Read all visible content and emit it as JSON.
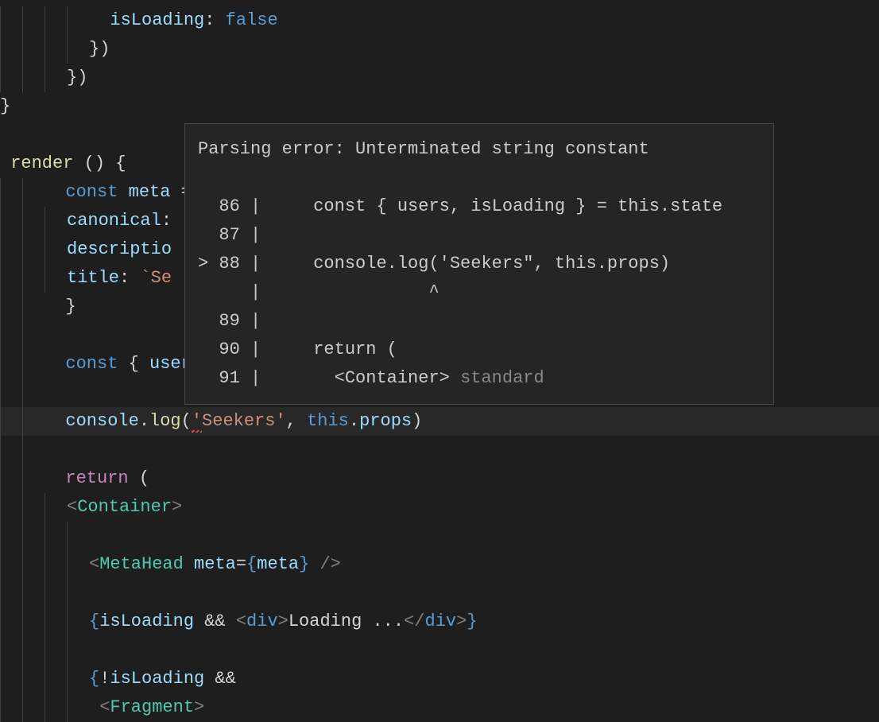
{
  "code": {
    "l1_prop": "isLoading",
    "l1_punc": ": ",
    "l1_val": "false",
    "l2": "})",
    "l3": "})",
    "l4": "}",
    "l6_func": "render",
    "l6_rest": " () {",
    "l7_const": "const",
    "l7_var": " meta",
    "l7_rest": " = ",
    "l8_prop": "canonical",
    "l8_punc": ":",
    "l9_prop": "descriptio",
    "l10_prop": "title",
    "l10_punc": ": ",
    "l10_tpl": "`Se",
    "l11": "}",
    "l13_const": "const",
    "l13_rest": " { ",
    "l13_var": "user",
    "l15_obj": "console",
    "l15_dot": ".",
    "l15_fn": "log",
    "l15_open": "(",
    "l15_quote": "'",
    "l15_str": "Seekers'",
    "l15_comma": ", ",
    "l15_this": "this",
    "l15_dot2": ".",
    "l15_props": "props",
    "l15_close": ")",
    "l17_return": "return",
    "l17_paren": " (",
    "l18_open": "<",
    "l18_tag": "Container",
    "l18_close": ">",
    "l20_open": "<",
    "l20_tag": "MetaHead",
    "l20_sp": " ",
    "l20_attr": "meta",
    "l20_eq": "=",
    "l20_bopen": "{",
    "l20_var": "meta",
    "l20_bclose": "}",
    "l20_end": " />",
    "l22_bopen": "{",
    "l22_var": "isLoading",
    "l22_and": " && ",
    "l22_topen": "<",
    "l22_tag": "div",
    "l22_tclose": ">",
    "l22_text": "Loading ...",
    "l22_cclose_open": "</",
    "l22_cclose_tag": "div",
    "l22_cclose_close": ">",
    "l22_bclose": "}",
    "l24_bopen": "{",
    "l24_not": "!",
    "l24_var": "isLoading",
    "l24_and": " &&",
    "l25_open": "<",
    "l25_tag": "Fragment",
    "l25_close": ">"
  },
  "tooltip": {
    "title": "Parsing error: Unterminated string constant",
    "l1_num": "  86 | ",
    "l1_code": "    const { users, isLoading } = this.state",
    "l2_num": "  87 | ",
    "l3_num": "> 88 | ",
    "l3_code": "    console.log('Seekers\", this.props)",
    "l4_num": "     | ",
    "l4_caret": "               ^",
    "l5_num": "  89 | ",
    "l6_num": "  90 | ",
    "l6_code": "    return (",
    "l7_num": "  91 | ",
    "l7_code": "      <Container> ",
    "l7_suffix": "standard"
  }
}
